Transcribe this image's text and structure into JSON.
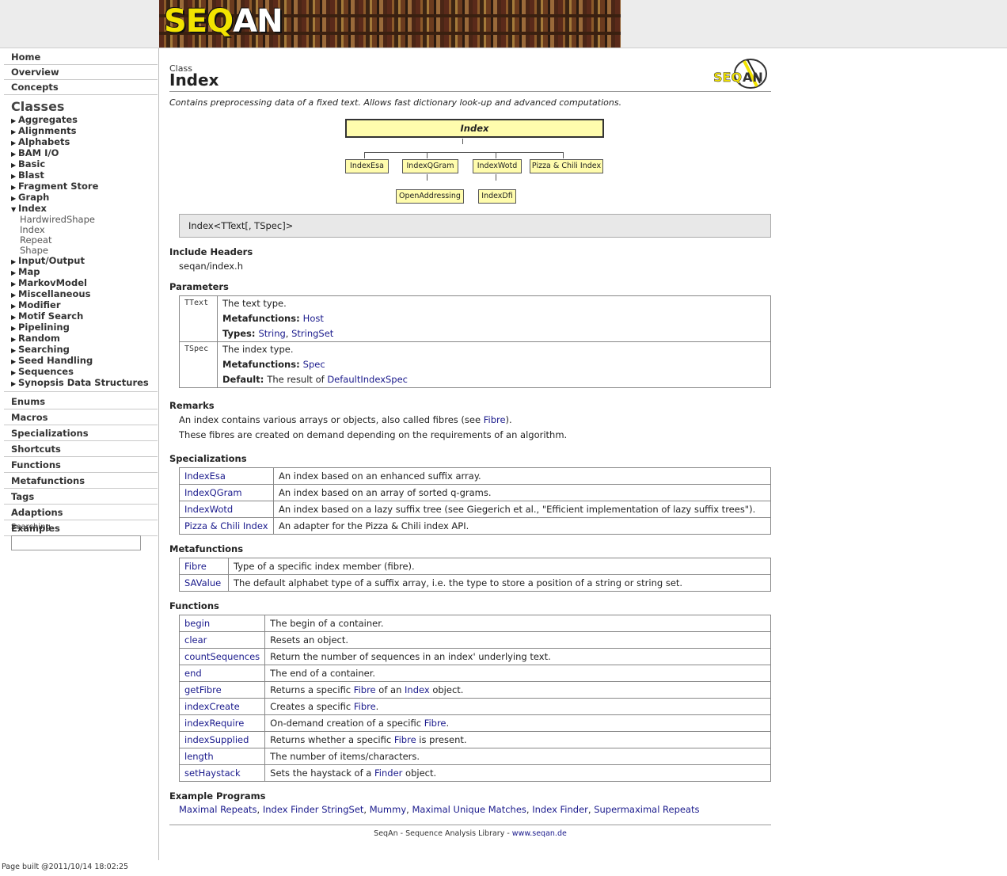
{
  "banner": {
    "logo_seq": "SEQ",
    "logo_an": "AN"
  },
  "sidebar": {
    "top_items": [
      "Home",
      "Overview",
      "Concepts"
    ],
    "classes_title": "Classes",
    "class_items": [
      "Aggregates",
      "Alignments",
      "Alphabets",
      "BAM I/O",
      "Basic",
      "Blast",
      "Fragment Store",
      "Graph",
      "Index"
    ],
    "index_subitems": [
      "HardwiredShape",
      "Index",
      "Repeat",
      "Shape"
    ],
    "class_items_after": [
      "Input/Output",
      "Map",
      "MarkovModel",
      "Miscellaneous",
      "Modifier",
      "Motif Search",
      "Pipelining",
      "Random",
      "Searching",
      "Seed Handling",
      "Sequences",
      "Synopsis Data Structures"
    ],
    "bottom_items": [
      "Enums",
      "Macros",
      "Specializations",
      "Shortcuts",
      "Functions",
      "Metafunctions",
      "Tags",
      "Adaptions",
      "Examples"
    ],
    "search_label": "Searching",
    "search_value": ""
  },
  "page": {
    "kind": "Class",
    "title": "Index",
    "logo_seq": "SEQ",
    "logo_an": "AN",
    "description": "Contains preprocessing data of a fixed text. Allows fast dictionary look-up and advanced computations.",
    "diagram": {
      "root": "Index",
      "children": [
        "IndexEsa",
        "IndexQGram",
        "IndexWotd",
        "Pizza & Chili Index"
      ],
      "grandchildren": [
        "OpenAddressing",
        "IndexDfi"
      ]
    },
    "signature": "Index<TText[, TSpec]>",
    "include_headers_title": "Include Headers",
    "include_header": "seqan/index.h",
    "parameters_title": "Parameters",
    "params": [
      {
        "name": "TText",
        "desc": "The text type.",
        "k1": "Metafunctions:",
        "v1": [
          "Host"
        ],
        "k2": "Types:",
        "v2": [
          "String",
          "StringSet"
        ]
      },
      {
        "name": "TSpec",
        "desc": "The index type.",
        "k1": "Metafunctions:",
        "v1": [
          "Spec"
        ],
        "k2": "Default:",
        "v2_prefix": "The result of",
        "v2": [
          "DefaultIndexSpec"
        ]
      }
    ],
    "remarks_title": "Remarks",
    "remark1_pre": "An index contains various arrays or objects, also called fibres (see ",
    "remark1_link": "Fibre",
    "remark1_post": ").",
    "remark2": "These fibres are created on demand depending on the requirements of an algorithm.",
    "specializations_title": "Specializations",
    "specializations": [
      {
        "name": "IndexEsa",
        "desc": "An index based on an enhanced suffix array."
      },
      {
        "name": "IndexQGram",
        "desc": "An index based on an array of sorted q-grams."
      },
      {
        "name": "IndexWotd",
        "desc": "An index based on a lazy suffix tree (see Giegerich et al., \"Efficient implementation of lazy suffix trees\")."
      },
      {
        "name": "Pizza & Chili Index",
        "desc": "An adapter for the Pizza & Chili index API."
      }
    ],
    "metafunctions_title": "Metafunctions",
    "metafunctions": [
      {
        "name": "Fibre",
        "desc": "Type of a specific index member (fibre)."
      },
      {
        "name": "SAValue",
        "desc": "The default alphabet type of a suffix array, i.e. the type to store a position of a string or string set."
      }
    ],
    "functions_title": "Functions",
    "functions": [
      {
        "name": "begin",
        "parts": [
          "The begin of a container."
        ]
      },
      {
        "name": "clear",
        "parts": [
          "Resets an object."
        ]
      },
      {
        "name": "countSequences",
        "parts": [
          "Return the number of sequences in an index' underlying text."
        ]
      },
      {
        "name": "end",
        "parts": [
          "The end of a container."
        ]
      },
      {
        "name": "getFibre",
        "parts": [
          "Returns a specific ",
          "Fibre",
          " of an ",
          "Index",
          " object."
        ]
      },
      {
        "name": "indexCreate",
        "parts": [
          "Creates a specific ",
          "Fibre",
          "."
        ]
      },
      {
        "name": "indexRequire",
        "parts": [
          "On-demand creation of a specific ",
          "Fibre",
          "."
        ]
      },
      {
        "name": "indexSupplied",
        "parts": [
          "Returns whether a specific ",
          "Fibre",
          " is present."
        ]
      },
      {
        "name": "length",
        "parts": [
          "The number of items/characters."
        ]
      },
      {
        "name": "setHaystack",
        "parts": [
          "Sets the haystack of a ",
          "Finder",
          " object."
        ]
      }
    ],
    "example_programs_title": "Example Programs",
    "example_programs": [
      "Maximal Repeats",
      "Index Finder StringSet",
      "Mummy",
      "Maximal Unique Matches",
      "Index Finder",
      "Supermaximal Repeats"
    ],
    "footer_text": "SeqAn - Sequence Analysis Library - ",
    "footer_link": "www.seqan.de"
  },
  "page_built": "Page built @2011/10/14 18:02:25",
  "colors": {
    "link": "#1a1a8c",
    "diagram_fill": "#fffcad",
    "signature_bg": "#e8e8e8",
    "logo_yellow": "#f2e300"
  }
}
